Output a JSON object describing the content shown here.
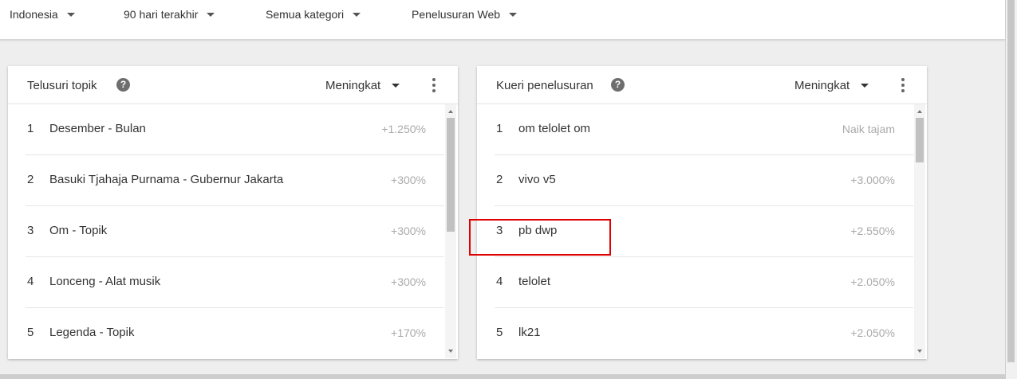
{
  "filters": [
    {
      "label": "Indonesia"
    },
    {
      "label": "90 hari terakhir"
    },
    {
      "label": "Semua kategori"
    },
    {
      "label": "Penelusuran Web"
    }
  ],
  "cards": [
    {
      "title": "Telusuri topik",
      "help_icon": "help-circle-icon",
      "help_glyph": "?",
      "sort_label": "Meningkat",
      "rows": [
        {
          "rank": "1",
          "label": "Desember - Bulan",
          "value": "+1.250%"
        },
        {
          "rank": "2",
          "label": "Basuki Tjahaja Purnama - Gubernur Jakarta",
          "value": "+300%"
        },
        {
          "rank": "3",
          "label": "Om - Topik",
          "value": "+300%"
        },
        {
          "rank": "4",
          "label": "Lonceng - Alat musik",
          "value": "+300%"
        },
        {
          "rank": "5",
          "label": "Legenda - Topik",
          "value": "+170%"
        }
      ]
    },
    {
      "title": "Kueri penelusuran",
      "help_icon": "help-circle-icon",
      "help_glyph": "?",
      "sort_label": "Meningkat",
      "rows": [
        {
          "rank": "1",
          "label": "om telolet om",
          "value": "Naik tajam"
        },
        {
          "rank": "2",
          "label": "vivo v5",
          "value": "+3.000%"
        },
        {
          "rank": "3",
          "label": "pb dwp",
          "value": "+2.550%"
        },
        {
          "rank": "4",
          "label": "telolet",
          "value": "+2.050%"
        },
        {
          "rank": "5",
          "label": "lk21",
          "value": "+2.050%"
        }
      ]
    }
  ],
  "colors": {
    "highlight": "#e00000",
    "page_bg": "#eeeeee",
    "muted_value": "#aaaaaa"
  }
}
